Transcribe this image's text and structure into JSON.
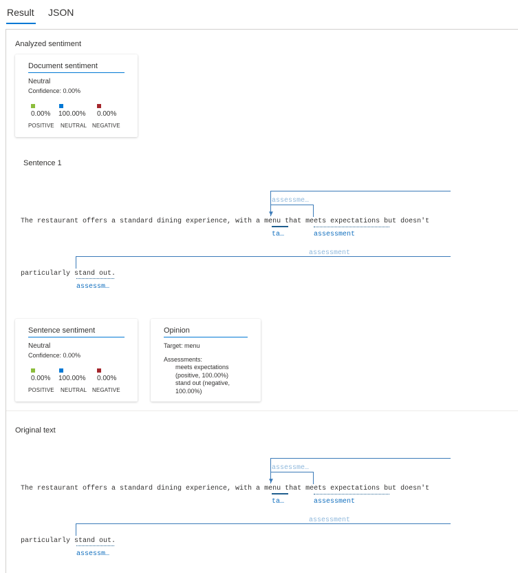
{
  "tabs": [
    {
      "label": "Result",
      "active": true
    },
    {
      "label": "JSON",
      "active": false
    }
  ],
  "analyzed": {
    "title": "Analyzed sentiment",
    "document_card": {
      "title": "Document sentiment",
      "sentiment": "Neutral",
      "confidence": "Confidence: 0.00%",
      "scores": [
        {
          "value": "0.00%",
          "label": "POSITIVE",
          "color": "#8cbd3c"
        },
        {
          "value": "100.00%",
          "label": "NEUTRAL",
          "color": "#0078d4"
        },
        {
          "value": "0.00%",
          "label": "NEGATIVE",
          "color": "#a4262c"
        }
      ]
    },
    "sentence_title": "Sentence 1",
    "sentence": {
      "line1": {
        "before": "The restaurant offers a standard dining experience, with a ",
        "target": "menu",
        "middle": " that ",
        "assessment": "meets expectations",
        "after": " but doesn't"
      },
      "line2": {
        "before": "particularly ",
        "assessment": "stand out",
        "after": "."
      },
      "tags": {
        "target_short": "ta…",
        "assessment_full": "assessment",
        "assessment_top": "assessme…",
        "assessment_faint": "assessment",
        "assessment_short": "assessm…"
      }
    },
    "sentence_card": {
      "title": "Sentence sentiment",
      "sentiment": "Neutral",
      "confidence": "Confidence: 0.00%",
      "scores": [
        {
          "value": "0.00%",
          "label": "POSITIVE",
          "color": "#8cbd3c"
        },
        {
          "value": "100.00%",
          "label": "NEUTRAL",
          "color": "#0078d4"
        },
        {
          "value": "0.00%",
          "label": "NEGATIVE",
          "color": "#a4262c"
        }
      ]
    },
    "opinion_card": {
      "title": "Opinion",
      "target": "Target: menu",
      "assessments_label": "Assessments:",
      "assessment_lines": [
        "meets expectations",
        "(positive, 100.00%)",
        "stand out (negative,",
        "100.00%)"
      ]
    }
  },
  "original": {
    "title": "Original text"
  }
}
